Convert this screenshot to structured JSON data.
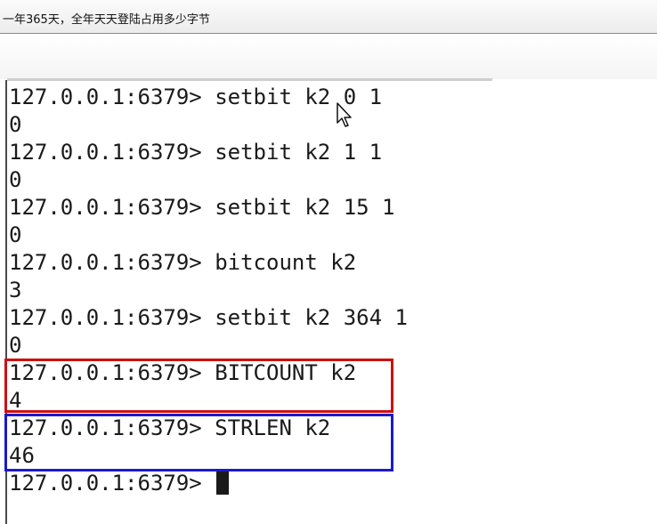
{
  "title_bar": {
    "text": "一年365天，全年天天登陆占用多少字节"
  },
  "terminal": {
    "prompt": "127.0.0.1:6379>",
    "lines": [
      {
        "cmd": "setbit k2 0 1",
        "output": "0"
      },
      {
        "cmd": "setbit k2 1 1",
        "output": "0"
      },
      {
        "cmd": "setbit k2 15 1",
        "output": "0"
      },
      {
        "cmd": "bitcount k2",
        "output": "3"
      },
      {
        "cmd": "setbit k2 364 1",
        "output": "0"
      },
      {
        "cmd": "BITCOUNT k2",
        "output": "4"
      },
      {
        "cmd": "STRLEN k2",
        "output": "46"
      }
    ],
    "final_prompt": "127.0.0.1:6379>"
  },
  "highlights": {
    "red_color": "#cc1111",
    "blue_color": "#1a1acc"
  },
  "icons": {
    "pointer": "mouse-pointer-icon"
  }
}
